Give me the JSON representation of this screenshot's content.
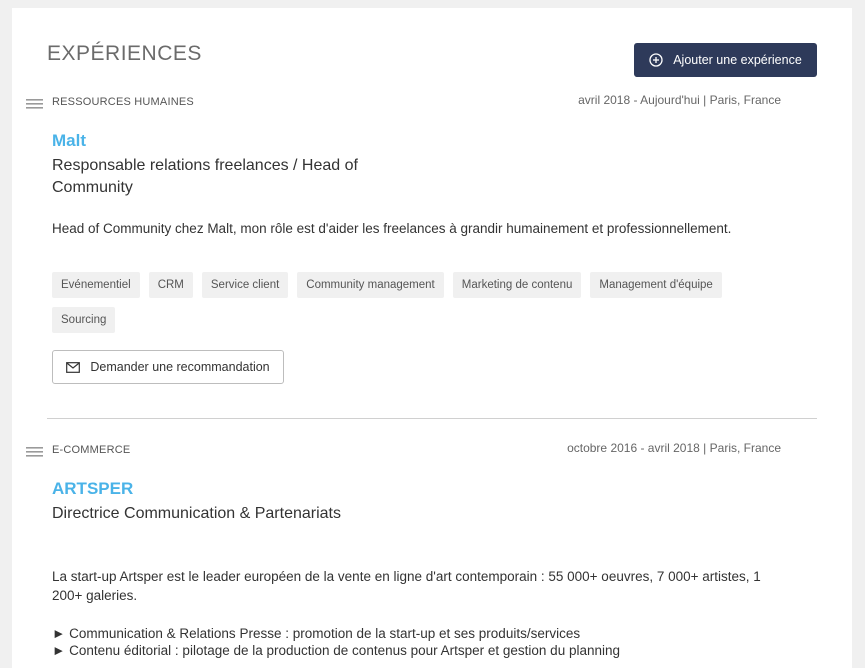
{
  "section": {
    "title": "EXPÉRIENCES",
    "add_button_label": "Ajouter une expérience"
  },
  "experiences": [
    {
      "category": "RESSOURCES HUMAINES",
      "period": "avril 2018 - Aujourd'hui",
      "location": "Paris, France",
      "company": "Malt",
      "role": "Responsable relations freelances / Head of Community",
      "description": "Head of Community chez Malt, mon rôle est d'aider les freelances à grandir humainement et professionnellement.",
      "tags": [
        "Evénementiel",
        "CRM",
        "Service client",
        "Community management",
        "Marketing de contenu",
        "Management d'équipe",
        "Sourcing"
      ],
      "recommendation_button_label": "Demander une recommandation"
    },
    {
      "category": "E-COMMERCE",
      "period": "octobre 2016 - avril 2018",
      "location": "Paris, France",
      "company": "ARTSPER",
      "role": "Directrice Communication & Partenariats",
      "description": "La start-up Artsper est le leader européen de la vente en ligne d'art contemporain : 55 000+ oeuvres, 7 000+ artistes, 1 200+ galeries.",
      "bullets": [
        "► Communication & Relations Presse : promotion de la start-up et ses produits/services",
        "► Contenu éditorial : pilotage de la production de contenus pour Artsper et gestion du planning"
      ]
    }
  ],
  "meta_separator": "|"
}
